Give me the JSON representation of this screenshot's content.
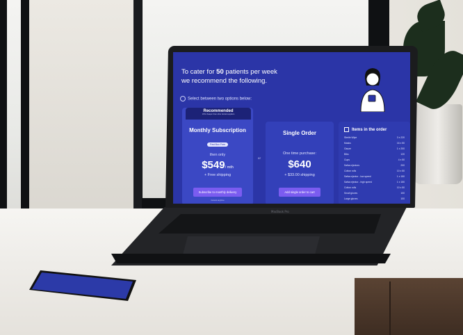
{
  "screen": {
    "headline_prefix": "To cater for",
    "patients": "50",
    "headline_suffix": "patients per week",
    "headline_line2": "we recommend the following.",
    "select_text": "Select between two options below:",
    "recommended": {
      "badge_title": "Recommended",
      "badge_subtitle": "10% cheaper than other dental suppliers",
      "title": "Monthly Subscription",
      "pill": "First Box Free",
      "then_only": "then only",
      "price": "$549",
      "price_unit": "/ mth",
      "shipping": "+ Free shipping",
      "cta": "Subscribe to monthly delivery",
      "footnote": "Cancel anytime"
    },
    "or_label": "or",
    "single": {
      "title": "Single Order",
      "subtitle": "One time purchase:",
      "price": "$640",
      "shipping": "+ $33.00 shipping",
      "cta": "Add single order to cart"
    },
    "items": {
      "title": "Items in the order",
      "rows": [
        {
          "name": "Sterile Wipe",
          "qty": "3 x 220"
        },
        {
          "name": "Masks",
          "qty": "16 x 50"
        },
        {
          "name": "Gauze",
          "qty": "1 x 200"
        },
        {
          "name": "Bibs",
          "qty": "120"
        },
        {
          "name": "Cups",
          "qty": "4 x 50"
        },
        {
          "name": "Saliva ejectors",
          "qty": "200"
        },
        {
          "name": "Cotton rolls",
          "qty": "10 x 50"
        },
        {
          "name": "Saliva ejector - low speed",
          "qty": "1 x 150"
        },
        {
          "name": "Saliva ejector - high speed",
          "qty": "1 x 150"
        },
        {
          "name": "Cotton rolls",
          "qty": "10 x 50"
        },
        {
          "name": "Small gloves",
          "qty": "100"
        },
        {
          "name": "Large gloves",
          "qty": "100"
        }
      ]
    }
  },
  "laptop_label": "MacBook Pro",
  "colors": {
    "screen_bg": "#2b35a7",
    "panel": "#3340b9",
    "badge": "#1c2277",
    "cta": "#7b5cf0"
  }
}
